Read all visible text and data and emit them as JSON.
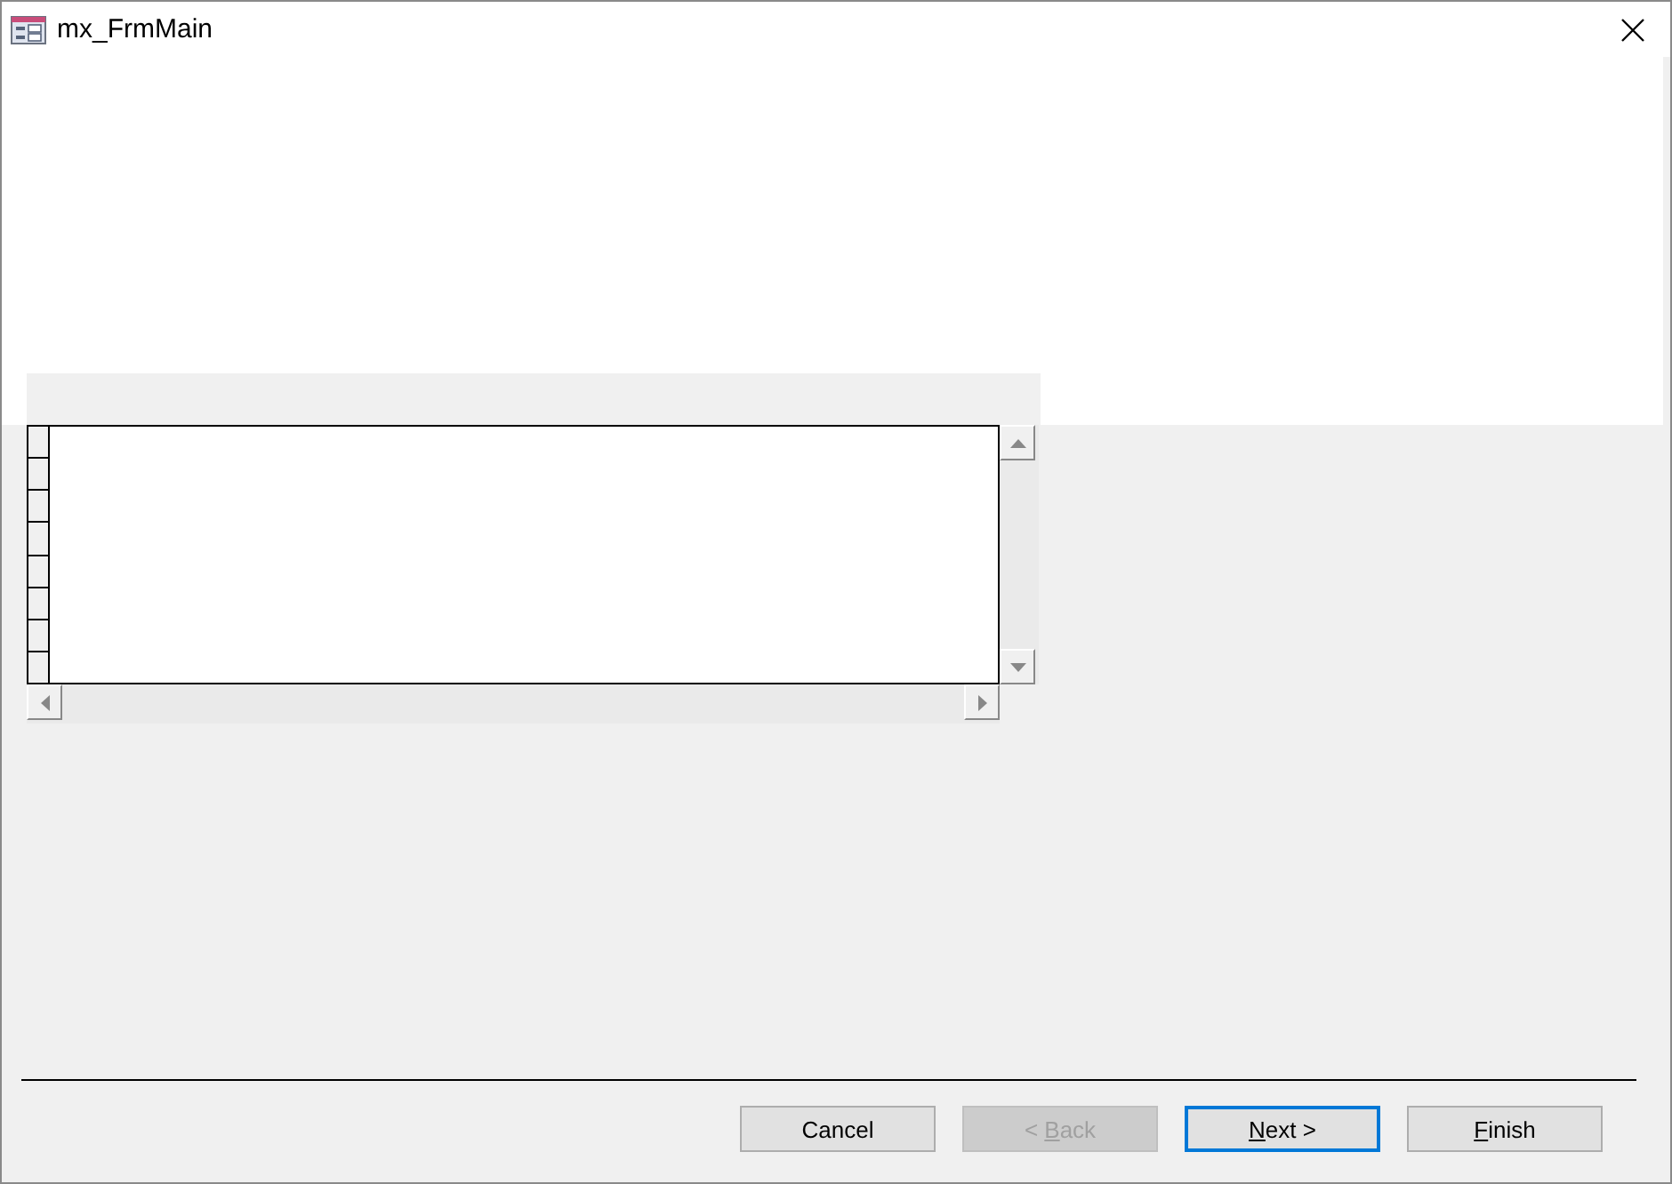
{
  "window": {
    "title": "mx_FrmMain"
  },
  "buttons": [
    {
      "label": [
        {
          "text": "Cancel",
          "underlined": false
        }
      ],
      "disabled": false,
      "focused": false
    },
    {
      "label": [
        {
          "text": "< ",
          "underlined": false
        },
        {
          "text": "B",
          "underlined": true
        },
        {
          "text": "ack",
          "underlined": false
        }
      ],
      "disabled": true,
      "focused": false
    },
    {
      "label": [
        {
          "text": "N",
          "underlined": true
        },
        {
          "text": "ext >",
          "underlined": false
        }
      ],
      "disabled": false,
      "focused": true
    },
    {
      "label": [
        {
          "text": "F",
          "underlined": true
        },
        {
          "text": "inish",
          "underlined": false
        }
      ],
      "disabled": false,
      "focused": false
    }
  ]
}
